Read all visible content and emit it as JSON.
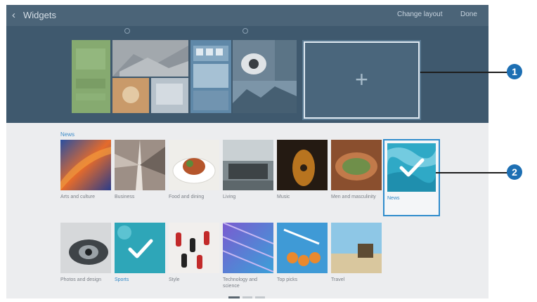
{
  "topbar": {
    "back_icon": "back-arrow-icon",
    "title": "Widgets",
    "change_layout": "Change layout",
    "done": "Done"
  },
  "home_area": {
    "add_panel_icon": "plus-icon"
  },
  "picker": {
    "category_heading": "News",
    "rows": [
      [
        {
          "label": "Arts and culture",
          "selected": false
        },
        {
          "label": "Business",
          "selected": false
        },
        {
          "label": "Food and dining",
          "selected": false
        },
        {
          "label": "Living",
          "selected": false
        },
        {
          "label": "Music",
          "selected": false
        },
        {
          "label": "Men and masculinity",
          "selected": false
        },
        {
          "label": "News",
          "selected": true
        }
      ],
      [
        {
          "label": "Photos and design",
          "selected": false
        },
        {
          "label": "Sports",
          "selected": true
        },
        {
          "label": "Style",
          "selected": false
        },
        {
          "label": "Technology and science",
          "selected": false
        },
        {
          "label": "Top picks",
          "selected": false
        },
        {
          "label": "Travel",
          "selected": false
        }
      ]
    ]
  },
  "callouts": {
    "one": "1",
    "two": "2"
  },
  "colors": {
    "topbar": "#4b6478",
    "home_area": "#3f596e",
    "accent": "#2f8ccc",
    "badge": "#1d6fb3"
  }
}
